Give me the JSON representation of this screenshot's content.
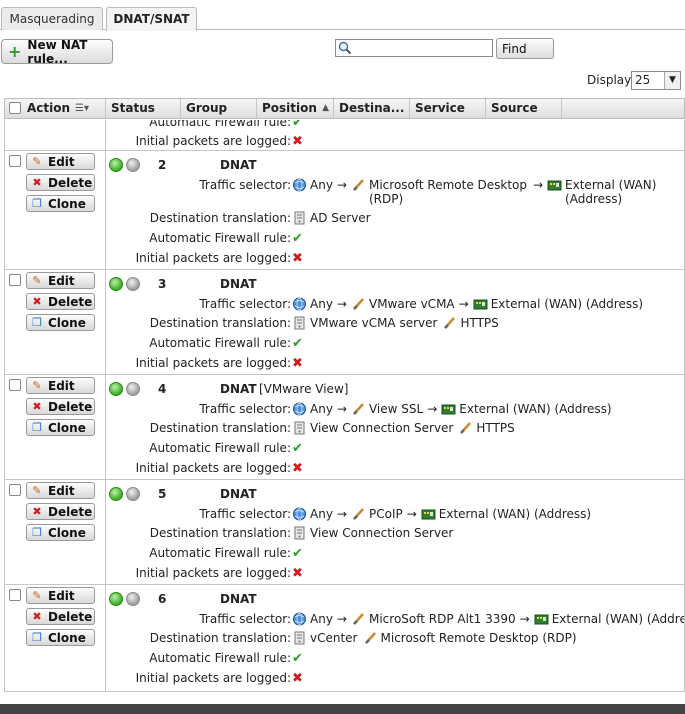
{
  "tabs": [
    "Masquerading",
    "DNAT/SNAT"
  ],
  "toolbar": {
    "new_nat_label": "New NAT rule...",
    "search_value": "",
    "find_label": "Find"
  },
  "display": {
    "label": "Display:",
    "value": "25"
  },
  "columns": [
    "Action",
    "Status",
    "Group",
    "Position",
    "Destina...",
    "Service",
    "Source"
  ],
  "action_labels": {
    "edit": "Edit",
    "delete": "Delete",
    "clone": "Clone"
  },
  "field_labels": {
    "traffic_selector": "Traffic selector:",
    "destination_translation": "Destination translation:",
    "automatic_firewall_rule": "Automatic Firewall rule:",
    "initial_packets_logged": "Initial packets are logged:"
  },
  "partial_row": {
    "automatic_firewall_rule_label": "Automatic Firewall rule:",
    "initial_packets_label": "Initial packets are logged:"
  },
  "rules": [
    {
      "position": "2",
      "type": "DNAT",
      "comment": "",
      "source": "Any",
      "service": "Microsoft Remote Desktop (RDP)",
      "destination": "External (WAN) (Address)",
      "translation_host": "AD Server",
      "translation_service": "",
      "auto_fw": "✔",
      "logged": "✖"
    },
    {
      "position": "3",
      "type": "DNAT",
      "comment": "",
      "source": "Any",
      "service": "VMware vCMA",
      "destination": "External (WAN) (Address)",
      "translation_host": "VMware vCMA server",
      "translation_service": "HTTPS",
      "auto_fw": "✔",
      "logged": "✖"
    },
    {
      "position": "4",
      "type": "DNAT",
      "comment": "[VMware View]",
      "source": "Any",
      "service": "View SSL",
      "destination": "External (WAN) (Address)",
      "translation_host": "View Connection Server",
      "translation_service": "HTTPS",
      "auto_fw": "✔",
      "logged": "✖"
    },
    {
      "position": "5",
      "type": "DNAT",
      "comment": "",
      "source": "Any",
      "service": "PCoIP",
      "destination": "External (WAN) (Address)",
      "translation_host": "View Connection Server",
      "translation_service": "",
      "auto_fw": "✔",
      "logged": "✖"
    },
    {
      "position": "6",
      "type": "DNAT",
      "comment": "",
      "source": "Any",
      "service": "MicroSoft RDP Alt1 3390",
      "destination": "External (WAN) (Address)",
      "translation_host": "vCenter",
      "translation_service": "Microsoft Remote Desktop (RDP)",
      "auto_fw": "✔",
      "logged": "✖"
    }
  ],
  "icons": {
    "globe": "globe-icon",
    "service": "service-icon",
    "interface": "network-interface-icon",
    "server": "server-icon"
  },
  "colors": {
    "accent_green": "#2e9a2e",
    "error_red": "#d21c1c",
    "header_bg": "#dedede",
    "footer_bg": "#444444"
  }
}
